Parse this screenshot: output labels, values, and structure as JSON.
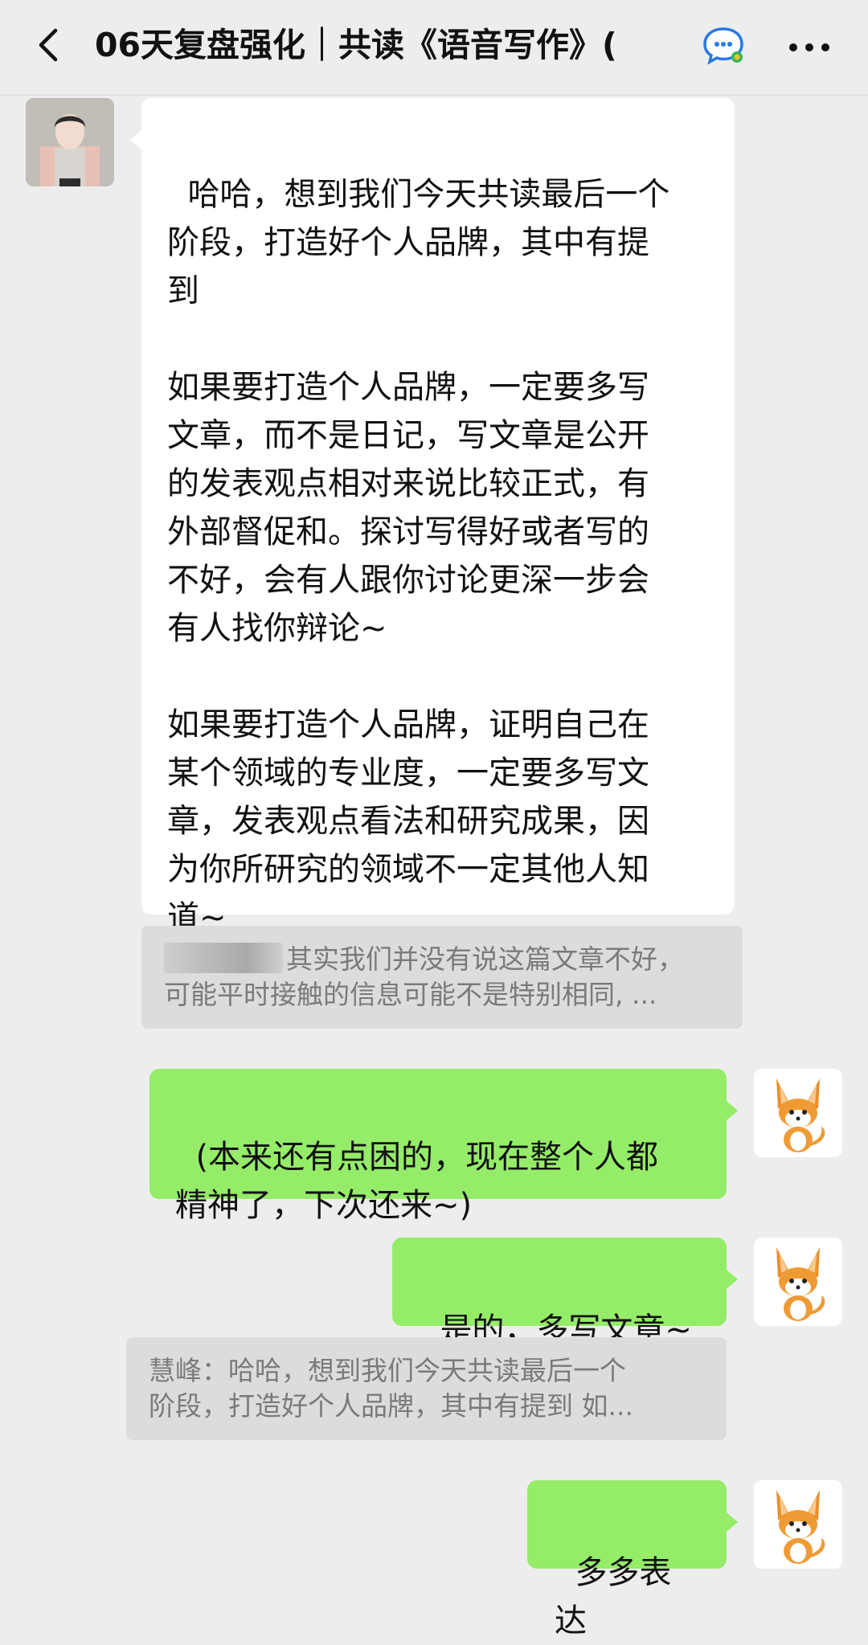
{
  "header": {
    "title": "06天复盘强化｜共读《语音写作》(",
    "back_icon": "chevron-left-icon",
    "chat_icon": "chat-bubble-icon",
    "more_icon": "more-dots-icon"
  },
  "messages": [
    {
      "side": "left",
      "text": "哈哈，想到我们今天共读最后一个\n阶段，打造好个人品牌，其中有提\n到\n\n如果要打造个人品牌，一定要多写\n文章，而不是日记，写文章是公开\n的发表观点相对来说比较正式，有\n外部督促和。探讨写得好或者写的\n不好，会有人跟你讨论更深一步会\n有人找你辩论~\n\n如果要打造个人品牌，证明自己在\n某个领域的专业度，一定要多写文\n章，发表观点看法和研究成果，因\n为你所研究的领域不一定其他人知\n道~"
    },
    {
      "quote_line1": "其实我们并没有说这篇文章不好，",
      "quote_line2": "可能平时接触的信息可能不是特别相同, ..."
    },
    {
      "side": "right",
      "text": "(本来还有点困的，现在整个人都\n精神了，下次还来~)"
    },
    {
      "side": "right",
      "text": "是的，多写文章~"
    },
    {
      "quote_line1": "慧峰：哈哈，想到我们今天共读最后一个",
      "quote_line2": "阶段，打造好个人品牌，其中有提到  如..."
    },
    {
      "side": "right",
      "text": "多多表达"
    }
  ],
  "colors": {
    "background": "#ededed",
    "incoming_bubble": "#ffffff",
    "outgoing_bubble": "#95ec69",
    "quote_bg": "#dcdcdc",
    "quote_text": "#7a7a7a"
  }
}
